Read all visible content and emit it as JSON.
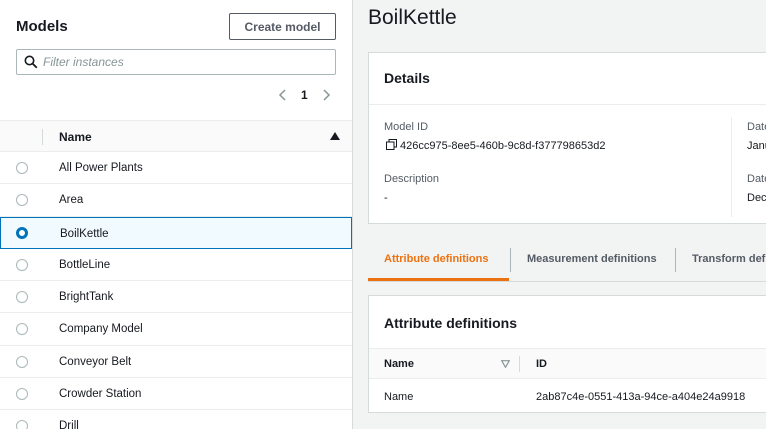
{
  "left_panel": {
    "title": "Models",
    "create_button": "Create model",
    "filter_placeholder": "Filter instances",
    "page_number": "1",
    "column_header": "Name",
    "rows": [
      {
        "label": "All Power Plants",
        "selected": false
      },
      {
        "label": "Area",
        "selected": false
      },
      {
        "label": "BoilKettle",
        "selected": true
      },
      {
        "label": "BottleLine",
        "selected": false
      },
      {
        "label": "BrightTank",
        "selected": false
      },
      {
        "label": "Company Model",
        "selected": false
      },
      {
        "label": "Conveyor Belt",
        "selected": false
      },
      {
        "label": "Crowder Station",
        "selected": false
      },
      {
        "label": "Drill",
        "selected": false
      }
    ]
  },
  "right_panel": {
    "title": "BoilKettle",
    "details": {
      "heading": "Details",
      "model_id_label": "Model ID",
      "model_id_value": "426cc975-8ee5-460b-9c8d-f377798653d2",
      "description_label": "Description",
      "description_value": "-",
      "date_label_1": "Date",
      "date_value_1": "Janu",
      "date_label_2": "Date",
      "date_value_2": "Dec"
    },
    "tabs": [
      {
        "label": "Attribute definitions",
        "active": true
      },
      {
        "label": "Measurement definitions",
        "active": false
      },
      {
        "label": "Transform defi",
        "active": false
      }
    ],
    "attributes": {
      "heading": "Attribute definitions",
      "col_name": "Name",
      "col_id": "ID",
      "rows": [
        {
          "name": "Name",
          "id": "2ab87c4e-0551-413a-94ce-a404e24a9918"
        }
      ]
    }
  },
  "colors": {
    "accent": "#ec7211",
    "selection": "#0073bb"
  },
  "icons": [
    "search-icon",
    "chevron-left-icon",
    "chevron-right-icon",
    "sort-ascending-icon",
    "copy-icon",
    "sort-descending-icon"
  ]
}
